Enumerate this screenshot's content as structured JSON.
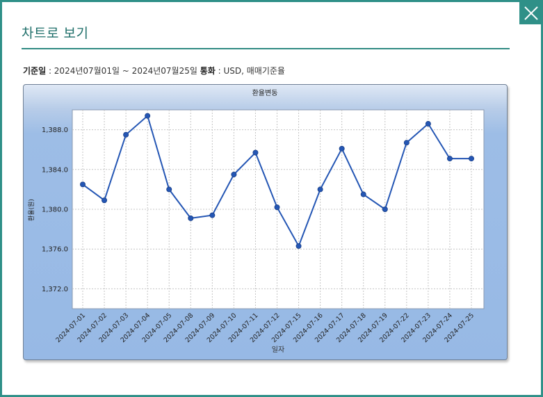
{
  "dialog": {
    "title": "차트로 보기",
    "info": {
      "date_label": "기준일",
      "date_range": " : 2024년07월01일 ~ 2024년07월25일 ",
      "currency_label": "통화",
      "currency_value": " : USD, 매매기준율"
    }
  },
  "chart_data": {
    "type": "line",
    "title": "환율변동",
    "xlabel": "일자",
    "ylabel": "환율(원)",
    "ylim": [
      1370,
      1390
    ],
    "yticks": [
      1372,
      1376,
      1380,
      1384,
      1388
    ],
    "ytick_labels": [
      "1,372.0",
      "1,376.0",
      "1,380.0",
      "1,384.0",
      "1,388.0"
    ],
    "grid": true,
    "categories": [
      "2024-07-01",
      "2024-07-02",
      "2024-07-03",
      "2024-07-04",
      "2024-07-05",
      "2024-07-08",
      "2024-07-09",
      "2024-07-10",
      "2024-07-11",
      "2024-07-12",
      "2024-07-15",
      "2024-07-16",
      "2024-07-17",
      "2024-07-18",
      "2024-07-19",
      "2024-07-22",
      "2024-07-23",
      "2024-07-24",
      "2024-07-25"
    ],
    "series": [
      {
        "values": [
          1382.5,
          1380.9,
          1387.5,
          1389.4,
          1382.0,
          1379.1,
          1379.4,
          1383.5,
          1385.7,
          1380.2,
          1376.3,
          1382.0,
          1386.1,
          1381.5,
          1380.0,
          1386.7,
          1388.6,
          1385.1,
          1385.1
        ],
        "color": "#2456b4"
      }
    ]
  }
}
